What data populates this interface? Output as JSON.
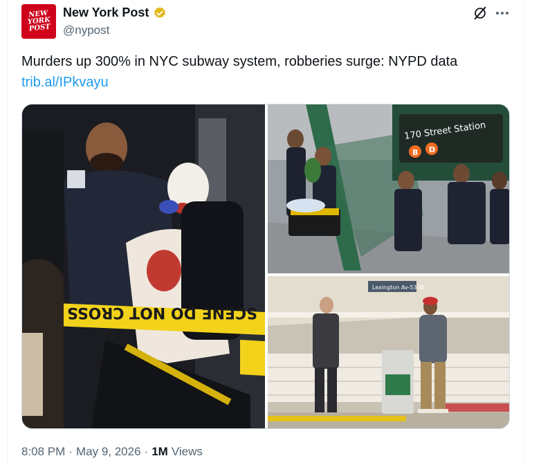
{
  "post": {
    "author_name": "New York Post",
    "author_handle": "@nypost",
    "avatar_text": "NEW\nYORK\nPOST",
    "verified_color": "#e2b719",
    "text": "Murders up 300% in NYC subway system, robberies surge: NYPD data",
    "link": "trib.al/IPkvayu",
    "time": "8:08 PM",
    "sep1": "·",
    "date": "May 9, 2026",
    "sep2": "·",
    "views_count": "1M",
    "views_label": "Views"
  },
  "images": {
    "left_tape_text": "SCENE DO NOT CROSS CRIN",
    "station_sign": "170 Street Station",
    "station_lines": [
      "B",
      "D"
    ],
    "platform_sign": "Lexington Av-53 St"
  },
  "colors": {
    "brand": "#d0021b",
    "link": "#1d9bf0",
    "muted": "#536471",
    "tape": "#f2d21b",
    "line_bd": "#f26c23"
  }
}
